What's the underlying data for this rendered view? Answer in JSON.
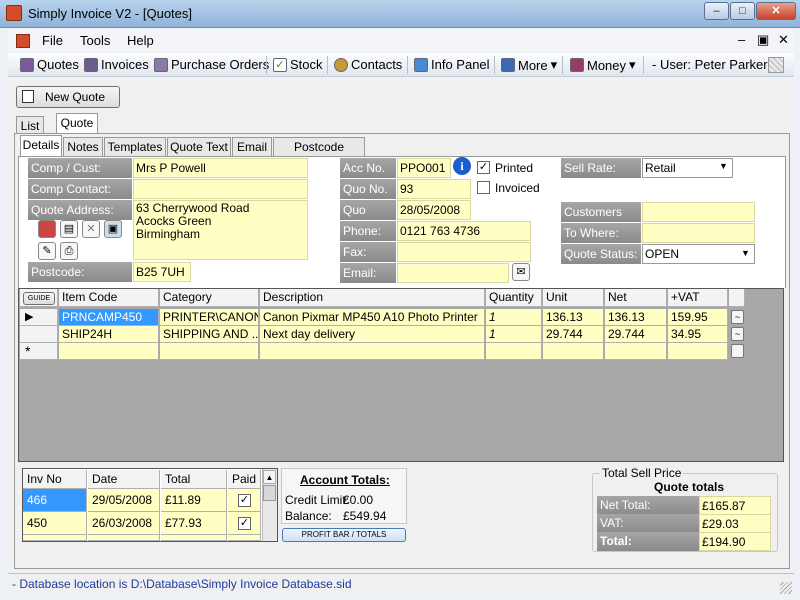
{
  "window": {
    "title": "Simply Invoice V2 - [Quotes]",
    "min": "–",
    "max": "□",
    "close": "✕"
  },
  "menu": {
    "file": "File",
    "tools": "Tools",
    "help": "Help",
    "mdi_min": "–",
    "mdi_restore": "▣",
    "mdi_close": "✕"
  },
  "toolbar": {
    "quotes": "Quotes",
    "invoices": "Invoices",
    "purchase_orders": "Purchase Orders",
    "stock": "Stock",
    "contacts": "Contacts",
    "info_panel": "Info Panel",
    "more": "More",
    "money": "Money",
    "dropdown_arrow": "▾",
    "user": "- User: Peter Parker"
  },
  "new_quote": "New Quote",
  "outer_tabs": [
    "List",
    "Quote"
  ],
  "inner_tabs": [
    "Details",
    "Notes",
    "Templates",
    "Quote Text",
    "Email",
    "Postcode Search"
  ],
  "details": {
    "comp_cust_label": "Comp / Cust:",
    "comp_cust": "Mrs P Powell",
    "comp_contact_label": "Comp Contact:",
    "comp_contact": "",
    "quote_address_label": "Quote Address:",
    "quote_address": [
      "63 Cherrywood Road",
      "Acocks Green",
      "Birmingham"
    ],
    "postcode_label": "Postcode:",
    "postcode": "B25 7UH",
    "acc_no_label": "Acc No.",
    "acc_no": "PPO001",
    "quo_no_label": "Quo No.",
    "quo_no": "93",
    "quo_date_label": "Quo Date:",
    "quo_date": "28/05/2008",
    "phone_label": "Phone:",
    "phone": "0121 763 4736",
    "fax_label": "Fax:",
    "fax": "",
    "email_label": "Email:",
    "email": "",
    "printed_label": "Printed",
    "printed_checked": true,
    "invoiced_label": "Invoiced",
    "invoiced_checked": false,
    "sell_rate_label": "Sell Rate:",
    "sell_rate": "Retail",
    "customers_po_label": "Customers PO:",
    "customers_po": "",
    "to_where_label": "To Where:",
    "to_where": "",
    "quote_status_label": "Quote Status:",
    "quote_status": "OPEN",
    "info_glyph": "i",
    "check_glyph": "✓",
    "dropdown_glyph": "▼"
  },
  "items_grid": {
    "guide_label": "GUIDE",
    "headers": [
      "Item Code",
      "Category",
      "Description",
      "Quantity",
      "Unit",
      "Net",
      "+VAT"
    ],
    "rows": [
      [
        "PRNCAMP450",
        "PRINTER\\CANON",
        "Canon Pixmar MP450 A10 Photo Printer",
        "1",
        "136.13",
        "136.13",
        "159.95"
      ],
      [
        "SHIP24H",
        "SHIPPING AND ...",
        "Next day delivery",
        "1",
        "29.744",
        "29.744",
        "34.95"
      ]
    ],
    "current_row_marker": "▶",
    "new_row_marker": "*",
    "row_button": "~"
  },
  "invoices": {
    "headers": [
      "Inv No",
      "Date",
      "Total",
      "Paid"
    ],
    "rows": [
      [
        "466",
        "29/05/2008",
        "£11.89",
        true
      ],
      [
        "450",
        "26/03/2008",
        "£77.93",
        true
      ]
    ],
    "scroll_up": "▲"
  },
  "account_totals": {
    "title": "Account Totals:",
    "credit_limit_label": "Credit Limit:",
    "credit_limit": "£0.00",
    "balance_label": "Balance:",
    "balance": "£549.94",
    "profit_button": "PROFIT BAR / TOTALS"
  },
  "sell_totals": {
    "group_label": "Total Sell Price",
    "title": "Quote totals",
    "net_label": "Net Total:",
    "net": "£165.87",
    "vat_label": "VAT:",
    "vat": "£29.03",
    "total_label": "Total:",
    "total": "£194.90"
  },
  "status": "- Database location is D:\\Database\\Simply Invoice Database.sid",
  "colors": {
    "field_bg": "#ffffc4",
    "label_bg": "#9a9a9a",
    "selection": "#3399ff"
  }
}
